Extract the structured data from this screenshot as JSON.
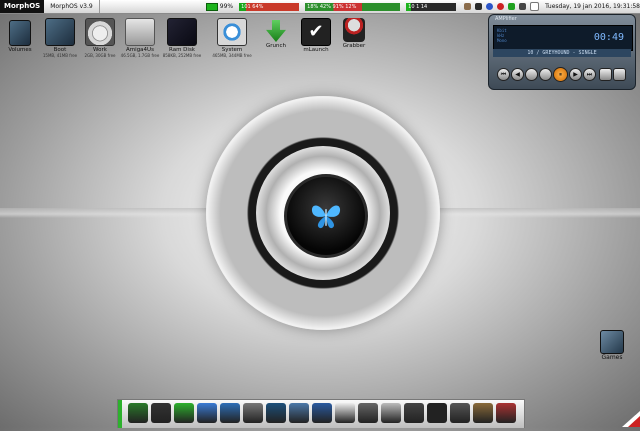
{
  "menubar": {
    "logo": "MorphOS",
    "version": "MorphOS v3.9",
    "meter1": "99%",
    "meter2": "101 64%",
    "meter3": "18% 42% 91% 12%",
    "meter4": "10 1 14",
    "clock": "Tuesday, 19 jan 2016, 19:31:58"
  },
  "desktop": {
    "icons": [
      {
        "label": "Volumes",
        "sub": ""
      },
      {
        "label": "Boot",
        "sub": "15MB, 41MB free"
      },
      {
        "label": "Work",
        "sub": "2GB, 30GB free"
      },
      {
        "label": "Amiga4Us",
        "sub": "46.5GB, 1.7GB free"
      },
      {
        "label": "Ram Disk",
        "sub": "858KB, 252MB free"
      },
      {
        "label": "System",
        "sub": "465MB, 344MB free"
      },
      {
        "label": "Grunch",
        "sub": ""
      },
      {
        "label": "mLaunch",
        "sub": ""
      },
      {
        "label": "Grabber",
        "sub": ""
      }
    ],
    "games_label": "Games"
  },
  "player": {
    "header": "AMPlifier",
    "time": "00:49",
    "info": [
      "Kbit",
      "kHz",
      "Mono",
      "Stereo"
    ],
    "track": "10 / GREYHOUND - SINGLE",
    "buttons": [
      "⏮",
      "◀",
      "⏸",
      "▶",
      "⏭"
    ]
  },
  "dock": {
    "items": [
      "workbench-icon",
      "filer-icon",
      "download-icon",
      "compass-icon",
      "globe-icon",
      "printer-icon",
      "monitor-icon",
      "image-icon",
      "magnifier-icon",
      "skull-icon",
      "gear-icon",
      "clock-icon",
      "speaker-icon",
      "equalizer-icon",
      "keyboard-icon",
      "film-icon",
      "grabber-icon"
    ]
  },
  "colors": {
    "accent_green": "#2db12d",
    "player_blue": "#5fa0ff",
    "play_orange": "#e07a0c"
  }
}
